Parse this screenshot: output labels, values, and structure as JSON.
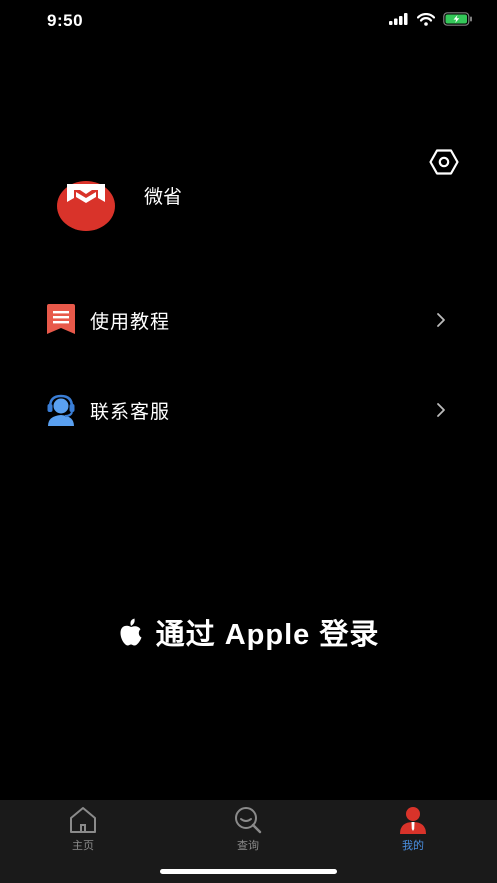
{
  "status_bar": {
    "time": "9:50"
  },
  "profile": {
    "username": "微省"
  },
  "menu": {
    "items": [
      {
        "label": "使用教程",
        "icon": "tutorial-book-icon"
      },
      {
        "label": "联系客服",
        "icon": "customer-service-icon"
      }
    ]
  },
  "login": {
    "apple_label": "通过 Apple 登录"
  },
  "tab_bar": {
    "tabs": [
      {
        "label": "主页",
        "icon": "home-icon",
        "active": false
      },
      {
        "label": "查询",
        "icon": "search-chat-icon",
        "active": false
      },
      {
        "label": "我的",
        "icon": "profile-icon",
        "active": true
      }
    ]
  },
  "colors": {
    "background": "#000000",
    "tab_bar_bg": "#1a1a1a",
    "active_tab": "#4a8fe0",
    "brand_red": "#d9332a",
    "tutorial_icon": "#e8594a",
    "service_icon": "#5aa0f0",
    "battery_green": "#34c759"
  }
}
